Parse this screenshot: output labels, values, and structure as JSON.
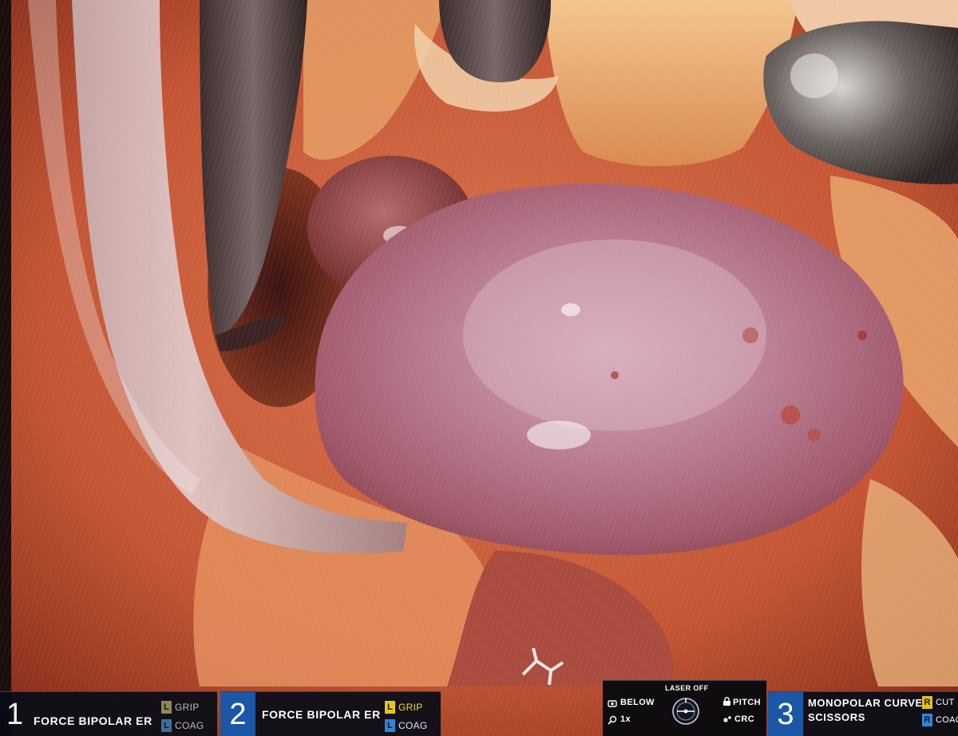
{
  "instruments": [
    {
      "arm": "1",
      "name": "FORCE BIPOLAR ER",
      "pedals": [
        {
          "key": "L",
          "label": "GRIP"
        },
        {
          "key": "L",
          "label": "COAG"
        }
      ]
    },
    {
      "arm": "2",
      "name": "FORCE BIPOLAR ER",
      "pedals": [
        {
          "key": "L",
          "label": "GRIP"
        },
        {
          "key": "L",
          "label": "COAG"
        }
      ]
    },
    {
      "arm": "3",
      "name_line1": "MONOPOLAR CURVED",
      "name_line2": "SCISSORS",
      "pedals": [
        {
          "key": "R",
          "label": "CUT"
        },
        {
          "key": "R",
          "label": "COAG"
        }
      ]
    }
  ],
  "camera": {
    "laser": "LASER OFF",
    "position": "BELOW",
    "zoom": "1x",
    "pitch": "PITCH",
    "crc": "CRC"
  },
  "colors": {
    "grip_key": "#d9c21b",
    "grip_key_dim": "#8f8a52",
    "coag_key": "#2f86d6",
    "cut_key": "#e0c21a",
    "active_arm": "#1b57a6",
    "panel_bg": "#080c16"
  },
  "icons": [
    "camera-below-icon",
    "zoom-icon",
    "horizon-dial-icon",
    "lock-pitch-icon",
    "crc-icon"
  ]
}
